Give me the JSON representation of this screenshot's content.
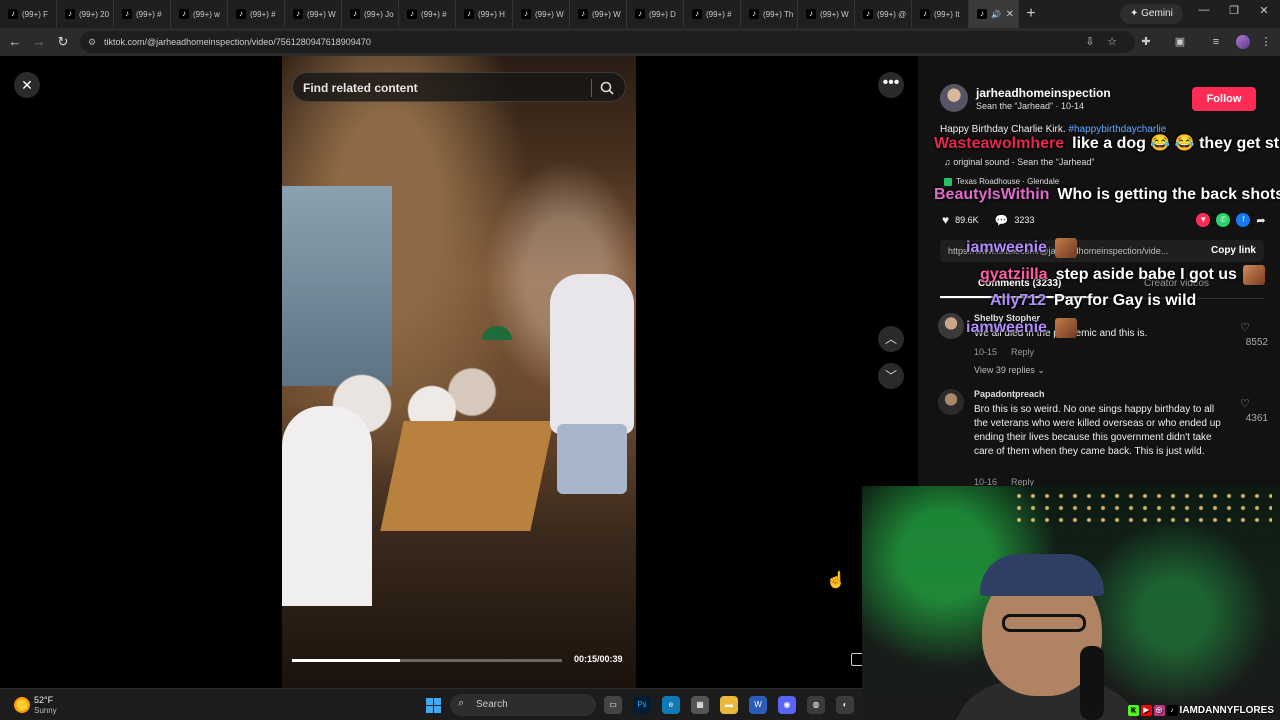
{
  "browser": {
    "tabs": [
      {
        "label": "(99+) F"
      },
      {
        "label": "(99+) 20"
      },
      {
        "label": "(99+) #"
      },
      {
        "label": "(99+) w"
      },
      {
        "label": "(99+) #"
      },
      {
        "label": "(99+) W"
      },
      {
        "label": "(99+) Jo"
      },
      {
        "label": "(99+) #"
      },
      {
        "label": "(99+) H"
      },
      {
        "label": "(99+) W"
      },
      {
        "label": "(99+) W"
      },
      {
        "label": "(99+) D"
      },
      {
        "label": "(99+) #"
      },
      {
        "label": "(99+) Th"
      },
      {
        "label": "(99+) W"
      },
      {
        "label": "(99+) @"
      },
      {
        "label": "(99+) It"
      }
    ],
    "new_tab": "+",
    "gemini": "✦ Gemini",
    "url": "tiktok.com/@jarheadhomeinspection/video/7561280947618909470"
  },
  "video": {
    "search_placeholder": "Find related content",
    "timecode": "00:15/00:39",
    "progress": 0.4
  },
  "post": {
    "username": "jarheadhomeinspection",
    "subtitle": "Sean the “Jarhead” · 10-14",
    "follow": "Follow",
    "description": "Happy Birthday Charlie Kirk. ",
    "hashtag": "#happybirthdaycharlie",
    "sound": "♫  original sound - Sean the “Jarhead”",
    "location": "Texas Roadhouse · Glendale",
    "likes": "89.6K",
    "comments_count": "3233",
    "link": "https://www.tiktok.com/@jarheadhomeinspection/vide...",
    "copy_link": "Copy link",
    "tab_comments": "Comments (3233)",
    "tab_creator": "Creator videos"
  },
  "comments": [
    {
      "user": "Shelby Stopher",
      "text": "We all died in the pandemic and this is.",
      "date": "10-15",
      "reply": "Reply",
      "likes": "8552",
      "view_replies": "View 39 replies ⌄"
    },
    {
      "user": "Papadontpreach",
      "text": "Bro this is so weird. No one sings happy birthday to all the veterans who were killed overseas or who ended up ending their lives because this government didn't take care of them when they came back. This is just wild.",
      "date": "10-16",
      "reply": "Reply",
      "likes": "4361"
    }
  ],
  "stream_chat": [
    {
      "user": "Wasteawolmhere",
      "message": "like a dog 😂 😂 they get stuck",
      "color": "#e8264c"
    },
    {
      "user": "BeautyIsWithin",
      "message": "Who is getting the back shots though?",
      "color": "#e06ac9"
    },
    {
      "user": "iamweenie",
      "message": "",
      "color": "#b18cff"
    },
    {
      "user": "gyatziilla",
      "message": "step aside babe I got us",
      "color": "#ff5da8"
    },
    {
      "user": "Ally712",
      "message": "Pay for Gay is wild",
      "color": "#b18cff"
    },
    {
      "user": "iamweenie",
      "message": "",
      "color": "#b18cff"
    }
  ],
  "webcam": {
    "handle": "IAMDANNYFLORES"
  },
  "taskbar": {
    "temperature": "52°F",
    "condition": "Sunny",
    "search": "Search"
  }
}
